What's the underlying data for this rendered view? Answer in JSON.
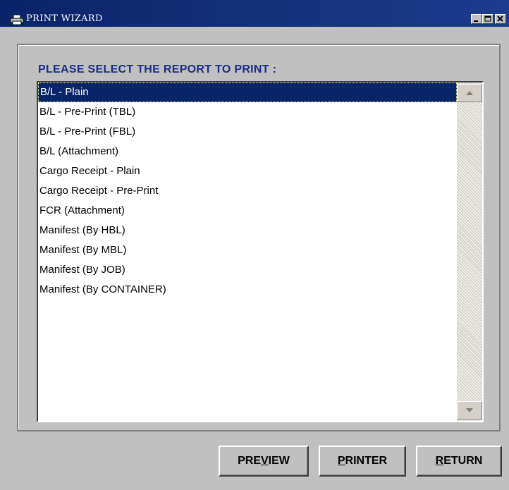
{
  "window": {
    "title": "PRINT WIZARD",
    "title_icon": "printer-icon",
    "controls": [
      "minimize-icon",
      "maximize-icon",
      "close-icon"
    ]
  },
  "prompt": "PLEASE SELECT THE REPORT TO PRINT :",
  "reports": {
    "selected_index": 0,
    "items": [
      "B/L - Plain",
      "B/L - Pre-Print (TBL)",
      "B/L - Pre-Print (FBL)",
      "B/L (Attachment)",
      "Cargo Receipt - Plain",
      "Cargo Receipt - Pre-Print",
      "FCR (Attachment)",
      "Manifest (By HBL)",
      "Manifest (By MBL)",
      "Manifest (By JOB)",
      "Manifest (By CONTAINER)"
    ]
  },
  "buttons": {
    "preview": {
      "pre": "PRE",
      "mnemonic": "V",
      "post": "IEW"
    },
    "printer": {
      "pre": "",
      "mnemonic": "P",
      "post": "RINTER"
    },
    "return": {
      "pre": "",
      "mnemonic": "R",
      "post": "ETURN"
    }
  },
  "colors": {
    "titlebar": "#0a246a",
    "prompt_text": "#1a2b8c",
    "selection": "#0a246a",
    "face": "#c0c0c0"
  }
}
